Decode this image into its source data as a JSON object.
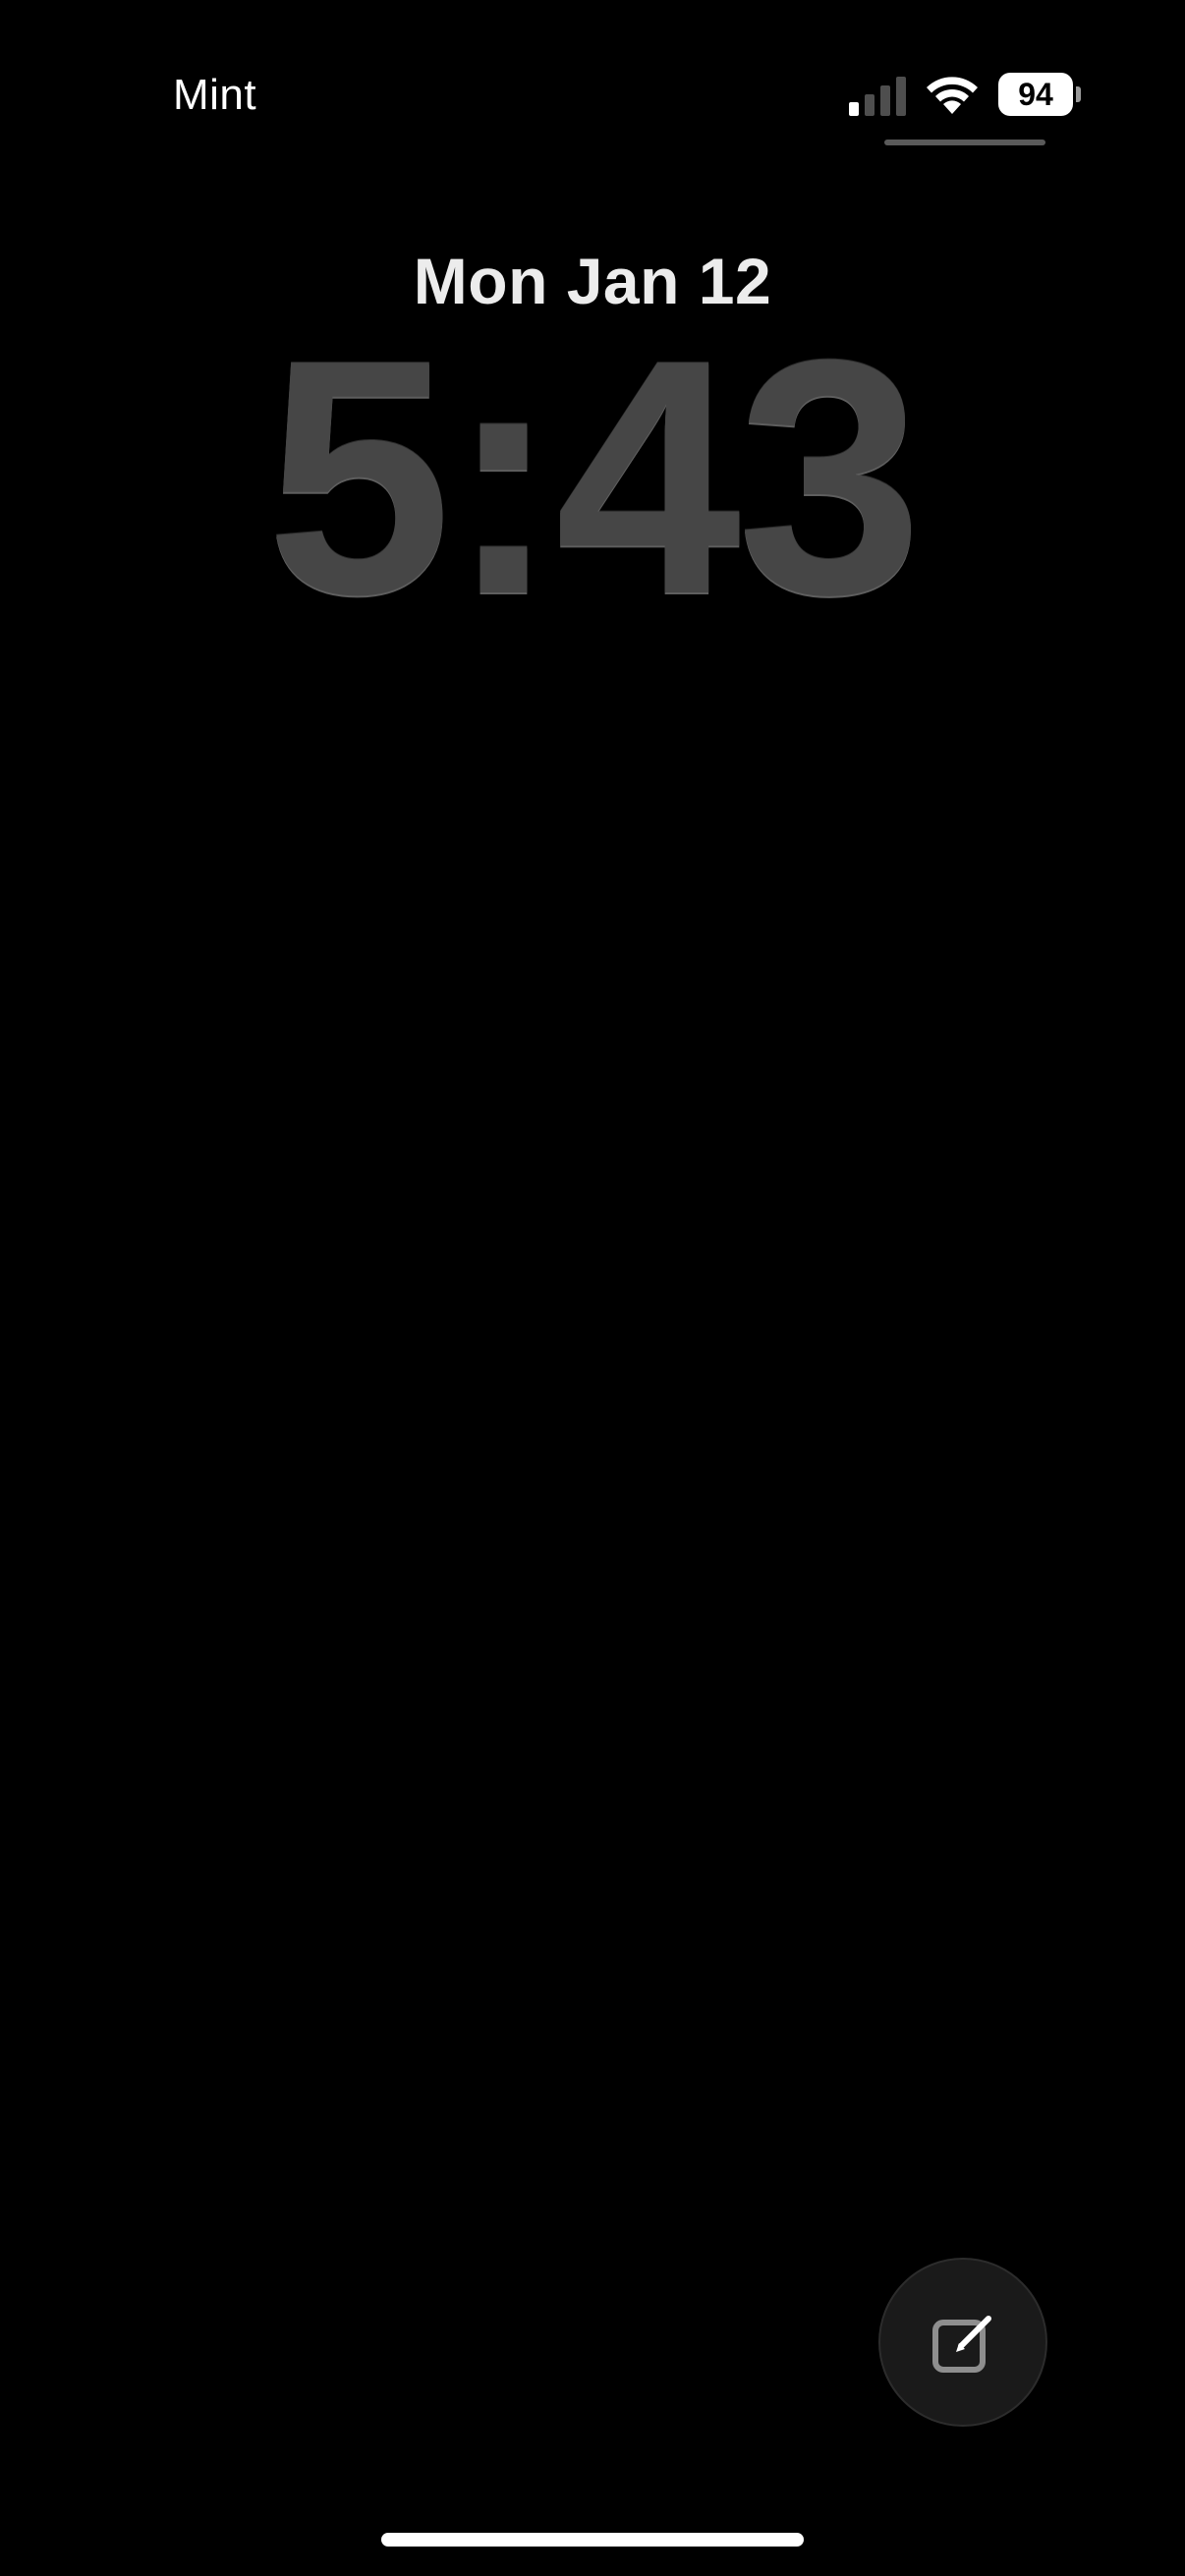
{
  "status_bar": {
    "carrier": "Mint",
    "battery_level": "94",
    "signal_icon": "cellular-signal-icon",
    "wifi_icon": "wifi-icon"
  },
  "lock_screen": {
    "date": "Mon Jan 12",
    "time": "5:43"
  },
  "shortcut": {
    "icon": "compose-icon"
  },
  "colors": {
    "background": "#000000",
    "clock": "#464646",
    "text": "#ffffff"
  }
}
